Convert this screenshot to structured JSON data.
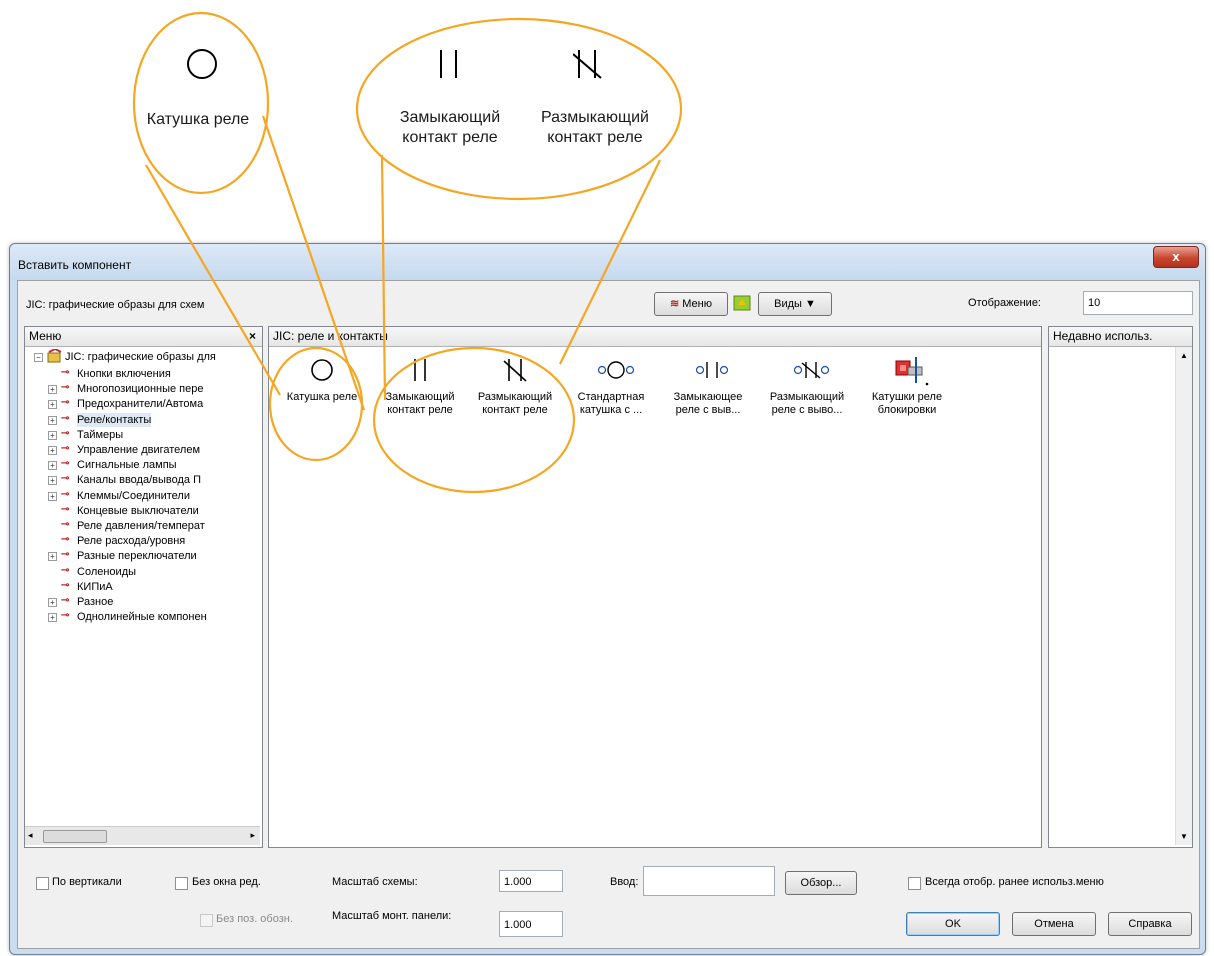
{
  "callout": {
    "coil_label": "Катушка реле",
    "no_contact_label": [
      "Замыкающий",
      "контакт реле"
    ],
    "nc_contact_label": [
      "Размыкающий",
      "контакт реле"
    ]
  },
  "window": {
    "title": "Вставить компонент",
    "close_label": "x"
  },
  "top": {
    "library_path": "JIC: графические образы для схем",
    "menu_button": "Меню",
    "views_button": "Виды",
    "display_label": "Отображение:",
    "display_value": "10"
  },
  "menu_panel": {
    "header": "Меню",
    "close": "×",
    "root": "JIC: графические образы для",
    "items": [
      {
        "label": "Кнопки включения",
        "expandable": false
      },
      {
        "label": "Многопозиционные пере",
        "expandable": true
      },
      {
        "label": "Предохранители/Автома",
        "expandable": true
      },
      {
        "label": "Реле/контакты",
        "expandable": true,
        "selected": true
      },
      {
        "label": "Таймеры",
        "expandable": true
      },
      {
        "label": "Управление двигателем",
        "expandable": true
      },
      {
        "label": "Сигнальные лампы",
        "expandable": true
      },
      {
        "label": "Каналы ввода/вывода П",
        "expandable": true
      },
      {
        "label": "Клеммы/Соединители",
        "expandable": true
      },
      {
        "label": "Концевые выключатели",
        "expandable": false
      },
      {
        "label": "Реле давления/температ",
        "expandable": false
      },
      {
        "label": "Реле расхода/уровня",
        "expandable": false
      },
      {
        "label": "Разные переключатели",
        "expandable": true
      },
      {
        "label": "Соленоиды",
        "expandable": false
      },
      {
        "label": "КИПиА",
        "expandable": false
      },
      {
        "label": "Разное",
        "expandable": true
      },
      {
        "label": "Однолинейные компонен",
        "expandable": true
      }
    ]
  },
  "content_panel": {
    "header": "JIC: реле и контакты",
    "tiles": [
      {
        "label": [
          "Катушка реле"
        ],
        "icon": "relay-coil-icon"
      },
      {
        "label": [
          "Замыкающий",
          "контакт реле"
        ],
        "icon": "no-contact-icon"
      },
      {
        "label": [
          "Размыкающий",
          "контакт реле"
        ],
        "icon": "nc-contact-icon"
      },
      {
        "label": [
          "Стандартная",
          "катушка с ..."
        ],
        "icon": "standard-coil-icon"
      },
      {
        "label": [
          "Замыкающее",
          "реле с выв..."
        ],
        "icon": "no-relay-terminal-icon"
      },
      {
        "label": [
          "Размыкающий",
          "реле с выво..."
        ],
        "icon": "nc-relay-terminal-icon"
      },
      {
        "label": [
          "Катушки реле",
          "блокировки"
        ],
        "icon": "interlock-coil-icon"
      }
    ]
  },
  "recent_panel": {
    "header": "Недавно использ."
  },
  "bottom": {
    "vertical_label": "По вертикали",
    "no_edit_label": "Без окна ред.",
    "no_pos_label": "Без поз. обозн.",
    "scale_label": "Масштаб схемы:",
    "scale_value": "1.000",
    "panel_scale_label": "Масштаб монт. панели:",
    "panel_scale_value": "1.000",
    "input_label": "Ввод:",
    "input_value": "",
    "browse_button": "Обзор...",
    "always_show_label": "Всегда отобр. ранее использ.меню",
    "ok_button": "OK",
    "cancel_button": "Отмена",
    "help_button": "Справка"
  },
  "colors": {
    "callout_orange": "#f5a623",
    "dialog_frame": "#c9dcf0",
    "close_red": "#c9462f"
  }
}
